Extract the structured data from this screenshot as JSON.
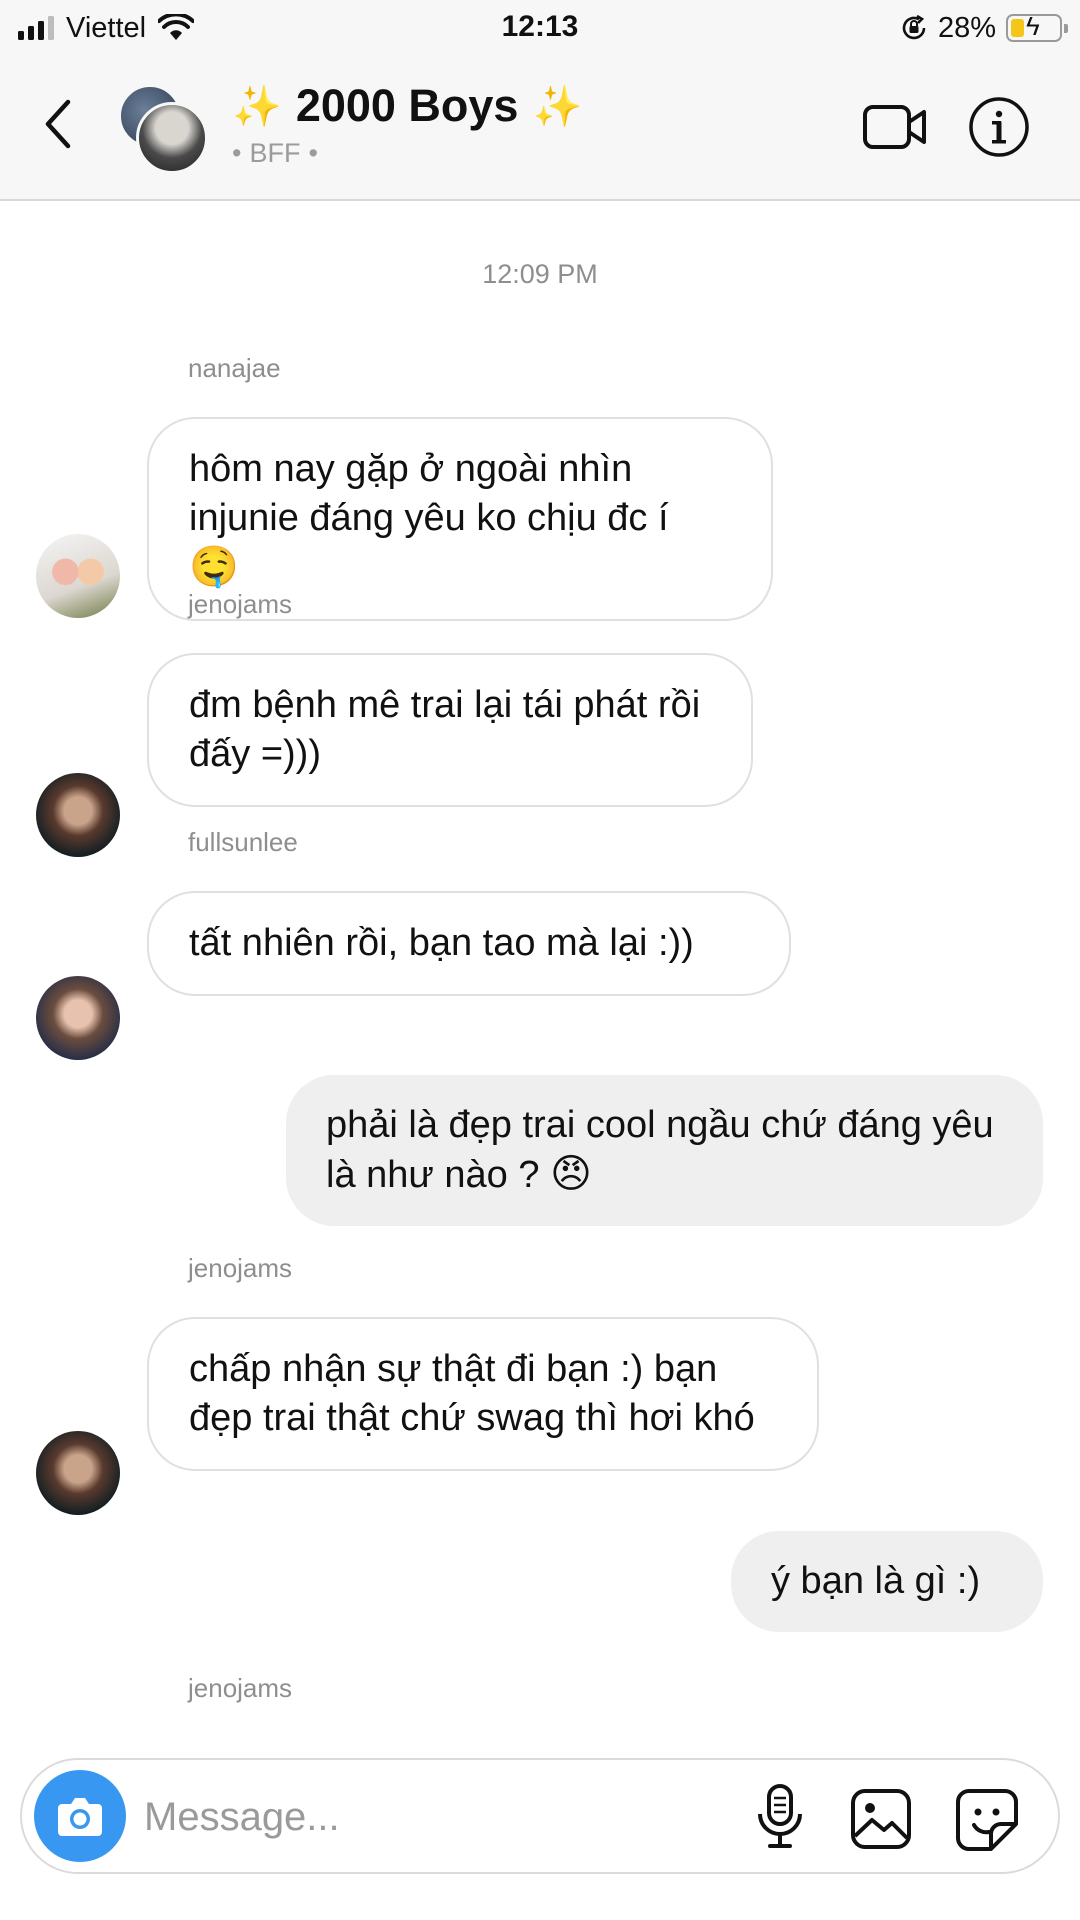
{
  "status_bar": {
    "carrier": "Viettel",
    "time": "12:13",
    "battery_percent": "28%",
    "battery_level": 0.28,
    "icons": [
      "signal-icon",
      "wifi-icon",
      "orientation-lock-icon",
      "battery-charging-icon"
    ]
  },
  "header": {
    "title": "2000 Boys",
    "title_decoration": "✨",
    "subtitle": "BFF",
    "subtitle_separator": "•",
    "icons": [
      "back-icon",
      "video-call-icon",
      "info-icon"
    ]
  },
  "conversation": {
    "timestamp": "12:09 PM",
    "messages": [
      {
        "direction": "in",
        "sender": "nanajae",
        "text": "hôm nay gặp ở ngoài nhìn injunie đáng yêu ko chịu đc í",
        "emoji": "🤤"
      },
      {
        "direction": "in",
        "sender": "jenojams",
        "text": "đm bệnh mê trai lại tái phát rồi đấy =)))"
      },
      {
        "direction": "in",
        "sender": "fullsunlee",
        "text": "tất nhiên rồi, bạn tao mà lại :))"
      },
      {
        "direction": "out",
        "text": "phải là đẹp trai cool ngầu chứ đáng yêu là như nào ?",
        "emoji": "😠"
      },
      {
        "direction": "in",
        "sender": "jenojams",
        "text": "chấp nhận sự thật đi bạn :) bạn đẹp trai thật chứ swag thì hơi khó"
      },
      {
        "direction": "out",
        "text": "ý bạn là gì :)"
      },
      {
        "direction": "in",
        "sender": "jenojams",
        "text": ""
      }
    ]
  },
  "composer": {
    "placeholder": "Message...",
    "value": "",
    "icons": [
      "camera-icon",
      "microphone-icon",
      "gallery-icon",
      "sticker-icon"
    ]
  },
  "colors": {
    "accent": "#3897f0",
    "sparkle": "#f5b400",
    "battery": "#f5c518",
    "outgoing_bubble": "#efefef",
    "incoming_border": "#e0e0e0",
    "muted_text": "#8e8e8e"
  }
}
